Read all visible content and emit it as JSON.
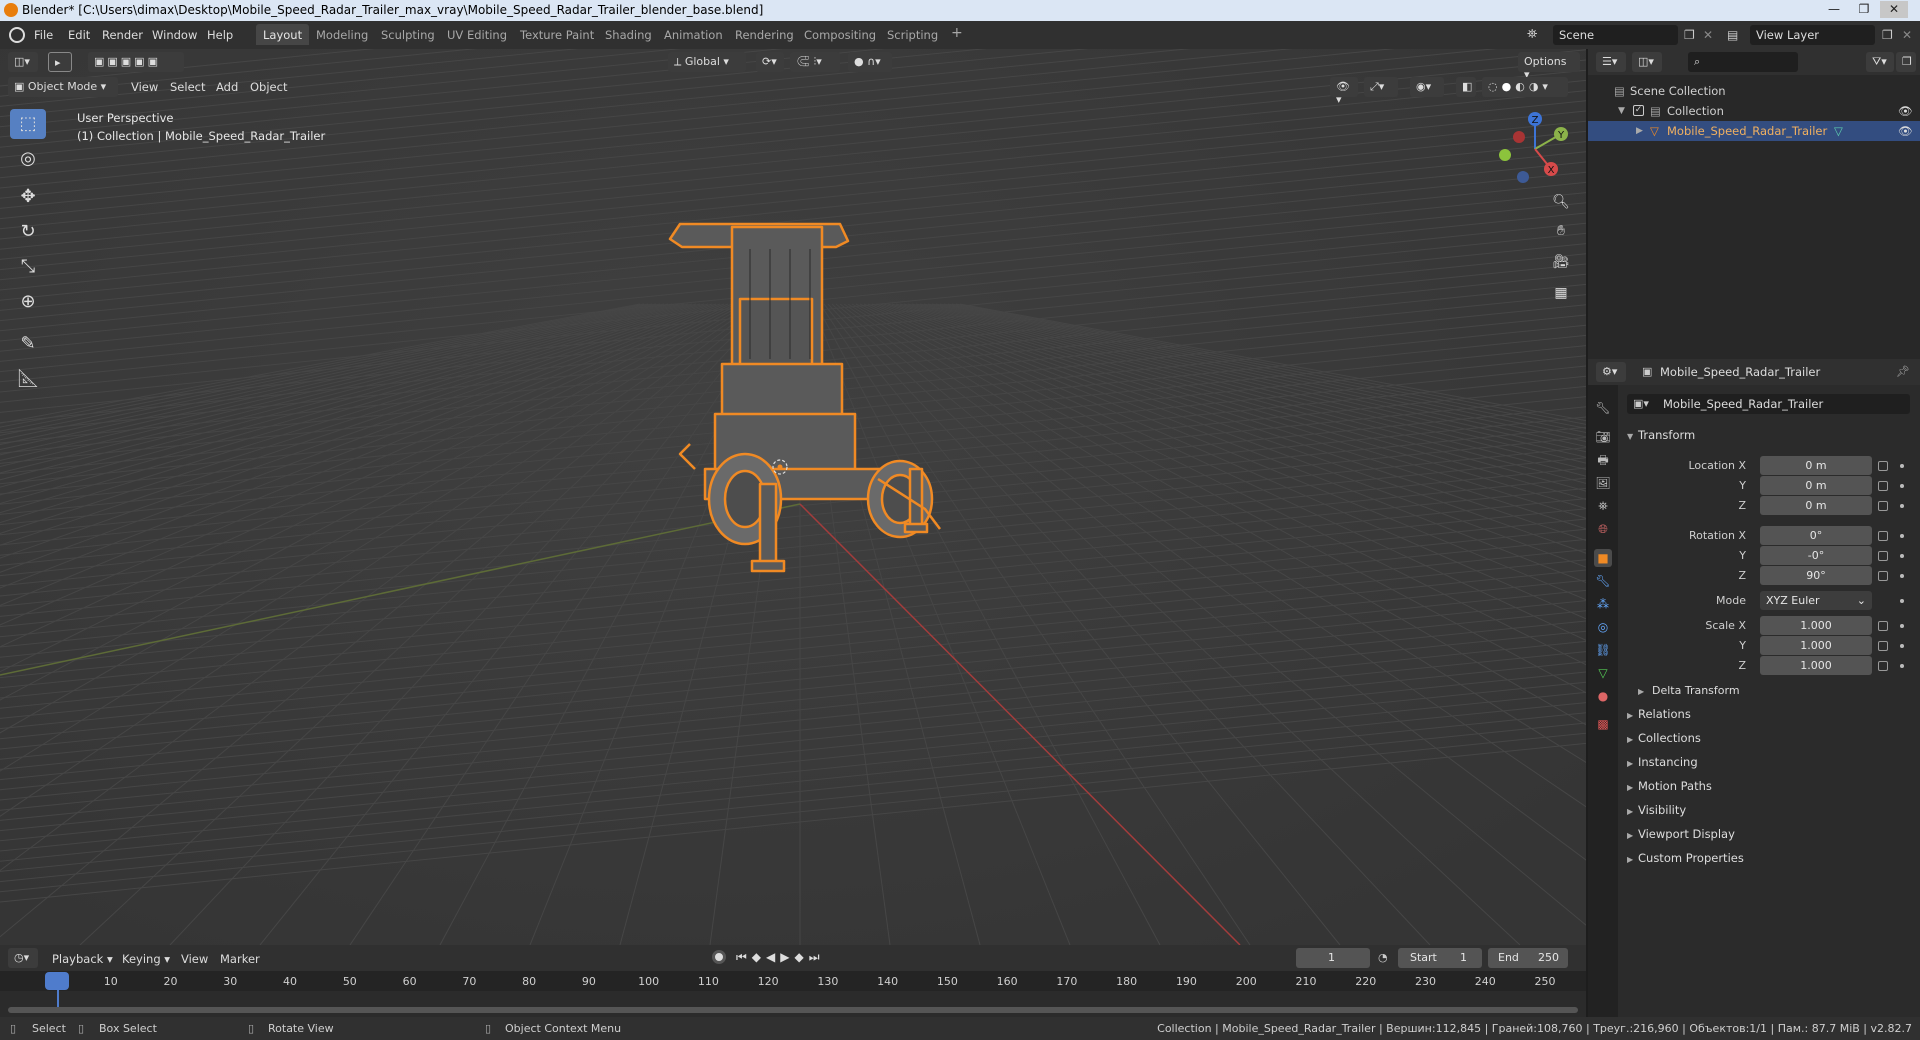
{
  "window": {
    "title": "Blender* [C:\\Users\\dimax\\Desktop\\Mobile_Speed_Radar_Trailer_max_vray\\Mobile_Speed_Radar_Trailer_blender_base.blend]",
    "minimize": "—",
    "maximize": "❐",
    "close": "✕"
  },
  "menu": {
    "items": [
      "File",
      "Edit",
      "Render",
      "Window",
      "Help"
    ]
  },
  "workspaces": {
    "tabs": [
      "Layout",
      "Modeling",
      "Sculpting",
      "UV Editing",
      "Texture Paint",
      "Shading",
      "Animation",
      "Rendering",
      "Compositing",
      "Scripting"
    ],
    "add": "+"
  },
  "scene": {
    "label": "Scene",
    "view_layer": "View Layer"
  },
  "viewport_header": {
    "transform_orientation": "Global",
    "options": "Options"
  },
  "viewport_header2": {
    "mode": "Object Mode",
    "menus": [
      "View",
      "Select",
      "Add",
      "Object"
    ]
  },
  "viewport_overlay": {
    "perspective": "User Perspective",
    "collection_info": "(1) Collection | Mobile_Speed_Radar_Trailer"
  },
  "gizmo": {
    "z": "Z",
    "y": "Y",
    "x": "X"
  },
  "outliner": {
    "root": "Scene Collection",
    "collection": "Collection",
    "object": "Mobile_Speed_Radar_Trailer"
  },
  "properties": {
    "header_object": "Mobile_Speed_Radar_Trailer",
    "datablock": "Mobile_Speed_Radar_Trailer",
    "transform": {
      "title": "Transform",
      "location_label": "Location X",
      "location": [
        "0 m",
        "0 m",
        "0 m"
      ],
      "rotation_label": "Rotation X",
      "rotation": [
        "0°",
        "-0°",
        "90°"
      ],
      "mode_label": "Mode",
      "mode": "XYZ Euler",
      "scale_label": "Scale X",
      "scale": [
        "1.000",
        "1.000",
        "1.000"
      ],
      "y": "Y",
      "z": "Z"
    },
    "delta_transform": "Delta Transform",
    "panels": [
      "Relations",
      "Collections",
      "Instancing",
      "Motion Paths",
      "Visibility",
      "Viewport Display",
      "Custom Properties"
    ]
  },
  "timeline": {
    "menus": [
      "Playback",
      "Keying",
      "View",
      "Marker"
    ],
    "current_frame": "1",
    "start_label": "Start",
    "start": "1",
    "end_label": "End",
    "end": "250",
    "ruler": [
      "1",
      "10",
      "20",
      "30",
      "40",
      "50",
      "60",
      "70",
      "80",
      "90",
      "100",
      "110",
      "120",
      "130",
      "140",
      "150",
      "160",
      "170",
      "180",
      "190",
      "200",
      "210",
      "220",
      "230",
      "240",
      "250"
    ]
  },
  "statusbar": {
    "select": "Select",
    "box_select": "Box Select",
    "rotate_view": "Rotate View",
    "context_menu": "Object Context Menu",
    "stats": "Collection | Mobile_Speed_Radar_Trailer | Вершин:112,845 | Граней:108,760 | Треуг.:216,960 | Объектов:1/1 | Пам.: 87.7 MiB | v2.82.7"
  },
  "colors": {
    "accent": "#5680c2",
    "selection": "#f08a24",
    "viewport_bg": "#3b3b3b",
    "axis_x": "#b83a3a",
    "axis_y": "#6f8f2f"
  }
}
